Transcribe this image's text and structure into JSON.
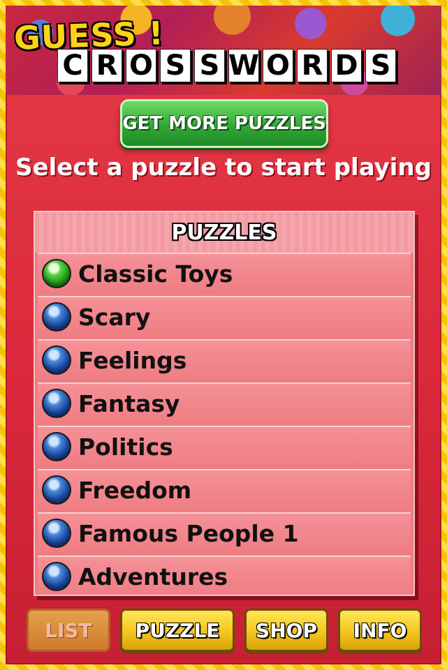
{
  "header": {
    "logo_top": "GUESS !",
    "logo_letters": [
      "C",
      "R",
      "O",
      "S",
      "S",
      "W",
      "O",
      "R",
      "D",
      "S"
    ]
  },
  "get_more_label": "GET MORE PUZZLES",
  "subtitle": "Select a puzzle to start playing",
  "panel": {
    "title": "PUZZLES",
    "items": [
      {
        "label": "Classic Toys",
        "status": "green"
      },
      {
        "label": "Scary",
        "status": "blue"
      },
      {
        "label": "Feelings",
        "status": "blue"
      },
      {
        "label": "Fantasy",
        "status": "blue"
      },
      {
        "label": "Politics",
        "status": "blue"
      },
      {
        "label": "Freedom",
        "status": "blue"
      },
      {
        "label": "Famous People 1",
        "status": "blue"
      },
      {
        "label": "Adventures",
        "status": "blue"
      }
    ]
  },
  "tabs": {
    "list": "LIST",
    "puzzle": "PUZZLE",
    "shop": "SHOP",
    "info": "INFO"
  },
  "colors": {
    "background_red": "#d9283a",
    "panel_pink": "#ee7d82",
    "button_green": "#33a835",
    "tab_yellow": "#f2c21a",
    "logo_yellow": "#ffd21a"
  }
}
